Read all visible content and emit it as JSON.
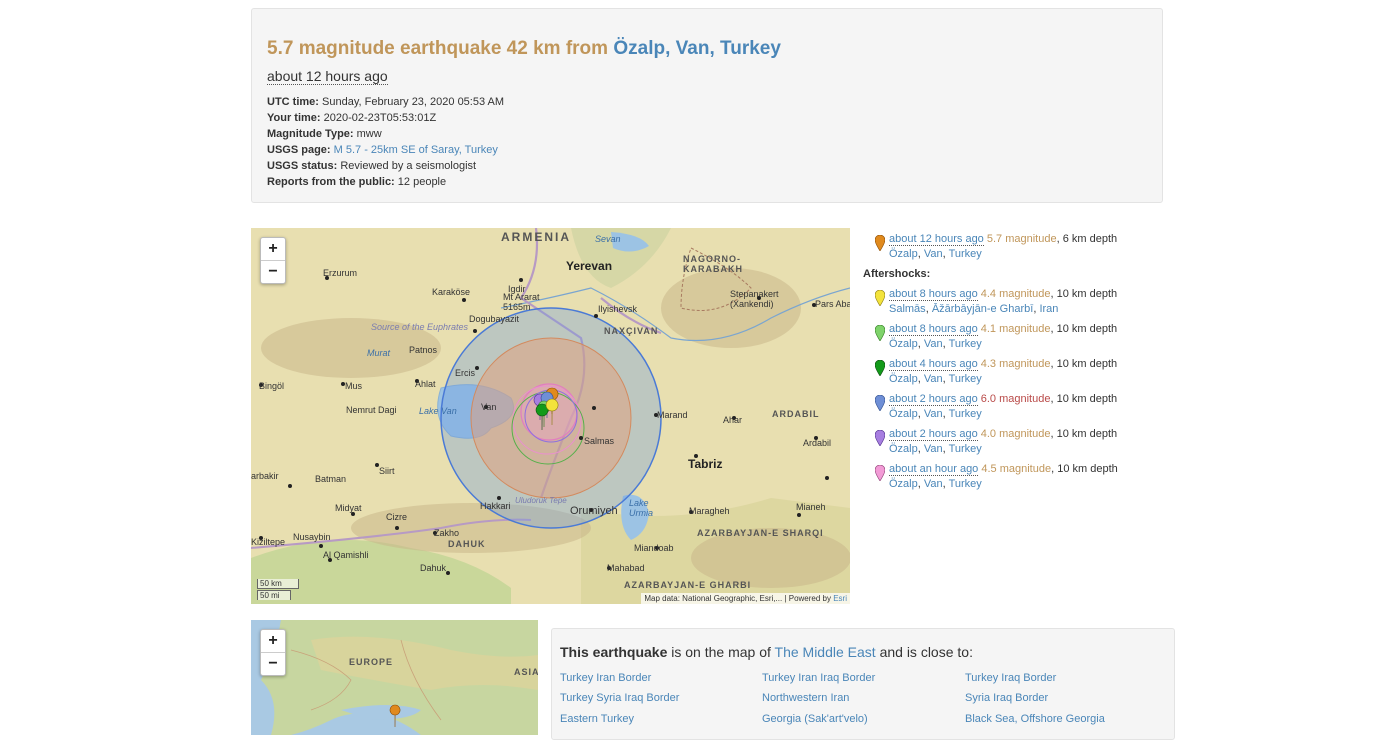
{
  "header": {
    "title_prefix": "5.7 magnitude earthquake 42 km from ",
    "place_city": "Özalp",
    "place_region": "Van",
    "place_country": "Turkey",
    "sep": ", ",
    "relative_time": "about 12 hours ago",
    "details": [
      {
        "label": "UTC time:",
        "value": "Sunday, February 23, 2020 05:53 AM"
      },
      {
        "label": "Your time:",
        "value": "2020-02-23T05:53:01Z"
      },
      {
        "label": "Magnitude Type:",
        "value": "mww"
      },
      {
        "label": "USGS page:",
        "value": "M 5.7 - 25km SE of Saray, Turkey",
        "link": true
      },
      {
        "label": "USGS status:",
        "value": "Reviewed by a seismologist"
      },
      {
        "label": "Reports from the public:",
        "value": "12 people"
      }
    ]
  },
  "map": {
    "zoom_in": "+",
    "zoom_out": "−",
    "scale_km": "50 km",
    "scale_mi": "50 mi",
    "attribution_prefix": "Map data: National Geographic, Esri,... | Powered by ",
    "attribution_link": "Esri",
    "labels": {
      "armenia": "ARMENIA",
      "sevan": "Sevan",
      "erzurum": "Erzurum",
      "igdir": "Igdir",
      "yerevan": "Yerevan",
      "nagorno": "NAGORNO-KARABAKH",
      "karakose": "Karaköse",
      "agri": "Mt Ararat 5165m",
      "ilyishevsk": "Ilyishevsk",
      "stepanakert": "Stepanakert (Xankendi)",
      "parsabad": "Pars Aba",
      "euphrates": "Source of the Euphrates",
      "dogubayazit": "Dogubayazit",
      "naxcivan": "NAXÇIVAN",
      "murat": "Murat",
      "patnos": "Patnos",
      "ercis": "Ercis",
      "bingol": "Bingöl",
      "mus": "Mus",
      "ahlat": "Ahlat",
      "ahar": "Ahar",
      "ardabil": "ARDABIL",
      "ardabil_city": "Ardabil",
      "nemrut": "Nemrut Dagi",
      "lakevan": "Lake Van",
      "van": "Van",
      "marand": "Marand",
      "salmas": "Salmas",
      "tabriz": "Tabriz",
      "siirt": "Siirt",
      "batman": "Batman",
      "diyarbakir": "arbakir",
      "midyat": "Midyat",
      "cizre": "Cizre",
      "hakkari": "Hakkari",
      "uludoruk": "Uludoruk Tepe",
      "orumiyeh": "Orumiyeh",
      "lakeurmia": "Lake Urmia",
      "maragheh": "Maragheh",
      "mianeh": "Mianeh",
      "azs": "AZARBAYJAN-E SHARQI",
      "kiziltepe": "Kiziltepe",
      "nusaybin": "Nusaybin",
      "zakho": "Zakho",
      "dahuk_r": "DAHUK",
      "qamishli": "Al Qamishli",
      "miandoab": "Miandoab",
      "dahuk": "Dahuk",
      "mahabad": "Mahabad",
      "azg": "AZARBAYJAN-E GHARBI"
    }
  },
  "events": {
    "main": {
      "ago": "about 12 hours ago",
      "mag": "5.7 magnitude",
      "depth": ", 6 km depth",
      "loc1": "Özalp",
      "loc2": "Van",
      "loc3": "Turkey",
      "color": "#e08a1e"
    },
    "aftershocks_heading": "Aftershocks:",
    "aftershocks": [
      {
        "ago": "about 8 hours ago",
        "mag": "4.4 magnitude",
        "depth": ", 10 km depth",
        "loc1": "Salmās",
        "loc2": "Āžārbāyjān-e Gharbī",
        "loc3": "Iran",
        "color": "#f3e33c",
        "red": false
      },
      {
        "ago": "about 8 hours ago",
        "mag": "4.1 magnitude",
        "depth": ", 10 km depth",
        "loc1": "Özalp",
        "loc2": "Van",
        "loc3": "Turkey",
        "color": "#7fd36b",
        "red": false
      },
      {
        "ago": "about 4 hours ago",
        "mag": "4.3 magnitude",
        "depth": ", 10 km depth",
        "loc1": "Özalp",
        "loc2": "Van",
        "loc3": "Turkey",
        "color": "#139a1a",
        "red": false
      },
      {
        "ago": "about 2 hours ago",
        "mag": "6.0 magnitude",
        "depth": ", 10 km depth",
        "loc1": "Özalp",
        "loc2": "Van",
        "loc3": "Turkey",
        "color": "#6f8fd6",
        "red": true
      },
      {
        "ago": "about 2 hours ago",
        "mag": "4.0 magnitude",
        "depth": ", 10 km depth",
        "loc1": "Özalp",
        "loc2": "Van",
        "loc3": "Turkey",
        "color": "#a77ee0",
        "red": false
      },
      {
        "ago": "about an hour ago",
        "mag": "4.5 magnitude",
        "depth": ", 10 km depth",
        "loc1": "Özalp",
        "loc2": "Van",
        "loc3": "Turkey",
        "color": "#f29bd6",
        "red": false
      }
    ]
  },
  "smallmap": {
    "zoom_in": "+",
    "zoom_out": "−",
    "europe": "EUROPE",
    "asia": "ASIA"
  },
  "nearby": {
    "intro_bold": "This earthquake",
    "intro_mid": " is on the map of ",
    "intro_link": "The Middle East",
    "intro_end": " and is close to:",
    "places": [
      "Turkey Iran Border",
      "Turkey Iran Iraq Border",
      "Turkey Iraq Border",
      "Turkey Syria Iraq Border",
      "Northwestern Iran",
      "Syria Iraq Border",
      "Eastern Turkey",
      "Georgia (Sak'art'velo)",
      "Black Sea, Offshore Georgia"
    ]
  }
}
